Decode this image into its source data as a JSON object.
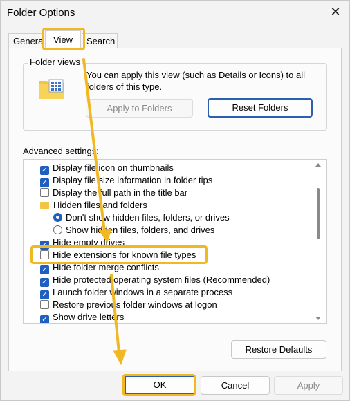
{
  "window": {
    "title": "Folder Options",
    "close_glyph": "✕"
  },
  "tabs": [
    {
      "label": "General"
    },
    {
      "label": "View"
    },
    {
      "label": "Search"
    }
  ],
  "folder_views": {
    "legend": "Folder views",
    "description": "You can apply this view (such as Details or Icons) to all folders of this type.",
    "apply_button": "Apply to Folders",
    "reset_button": "Reset Folders",
    "icon": "folder-grid-icon"
  },
  "advanced": {
    "label": "Advanced settings:",
    "items": [
      {
        "label": "Display file icon on thumbnails",
        "control": "checkbox",
        "checked": true
      },
      {
        "label": "Display file size information in folder tips",
        "control": "checkbox",
        "checked": true
      },
      {
        "label": "Display the full path in the title bar",
        "control": "checkbox",
        "checked": false
      },
      {
        "label": "Hidden files and folders",
        "control": "folder",
        "checked": false
      },
      {
        "label": "Don't show hidden files, folders, or drives",
        "control": "radio",
        "checked": true
      },
      {
        "label": "Show hidden files, folders, and drives",
        "control": "radio",
        "checked": false
      },
      {
        "label": "Hide empty drives",
        "control": "checkbox",
        "checked": true
      },
      {
        "label": "Hide extensions for known file types",
        "control": "checkbox",
        "checked": false
      },
      {
        "label": "Hide folder merge conflicts",
        "control": "checkbox",
        "checked": true
      },
      {
        "label": "Hide protected operating system files (Recommended)",
        "control": "checkbox",
        "checked": true
      },
      {
        "label": "Launch folder windows in a separate process",
        "control": "checkbox",
        "checked": true
      },
      {
        "label": "Restore previous folder windows at logon",
        "control": "checkbox",
        "checked": false
      },
      {
        "label": "Show drive letters",
        "control": "checkbox",
        "checked": true
      }
    ],
    "restore_button": "Restore Defaults"
  },
  "footer": {
    "ok": "OK",
    "cancel": "Cancel",
    "apply": "Apply"
  },
  "check_glyph": "✓",
  "colors": {
    "accent": "#1f5fbf",
    "highlight": "#f2b824",
    "folder": "#f4c542"
  }
}
